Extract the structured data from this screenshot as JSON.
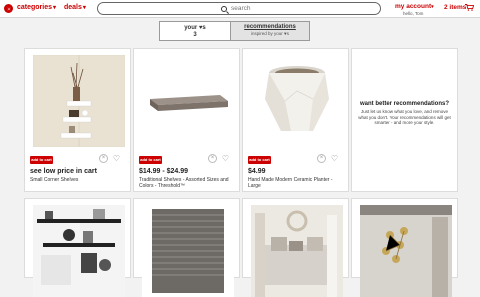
{
  "header": {
    "categories_label": "categories",
    "deals_label": "deals",
    "search_placeholder": "search",
    "account_label": "my account",
    "account_hello": "hello, Tom",
    "items_label": "2 items"
  },
  "tabs": {
    "your_hearts_label": "your ♥s",
    "your_hearts_count": "3",
    "recommendations_label": "recommendations",
    "recommendations_sub": "inspired by your ♥s"
  },
  "products": [
    {
      "add_label": "add to cart",
      "price": "see low price in cart",
      "description": "Small Corner Shelves"
    },
    {
      "add_label": "add to cart",
      "price": "$14.99 - $24.99",
      "description": "Traditional Shelves - Assorted Sizes and Colors - Threshold™"
    },
    {
      "add_label": "add to cart",
      "price": "$4.99",
      "description": "Hand Made Modern Ceramic Planter - Large"
    }
  ],
  "better_recs": {
    "title": "want better recommendations?",
    "body": "Just let us know what you love, and remove what you don't. Your recommendations will get smarter - and more your style."
  },
  "icons": {
    "dismiss": "x-icon",
    "favorite": "heart-icon"
  },
  "colors": {
    "brand_red": "#cc0000"
  }
}
